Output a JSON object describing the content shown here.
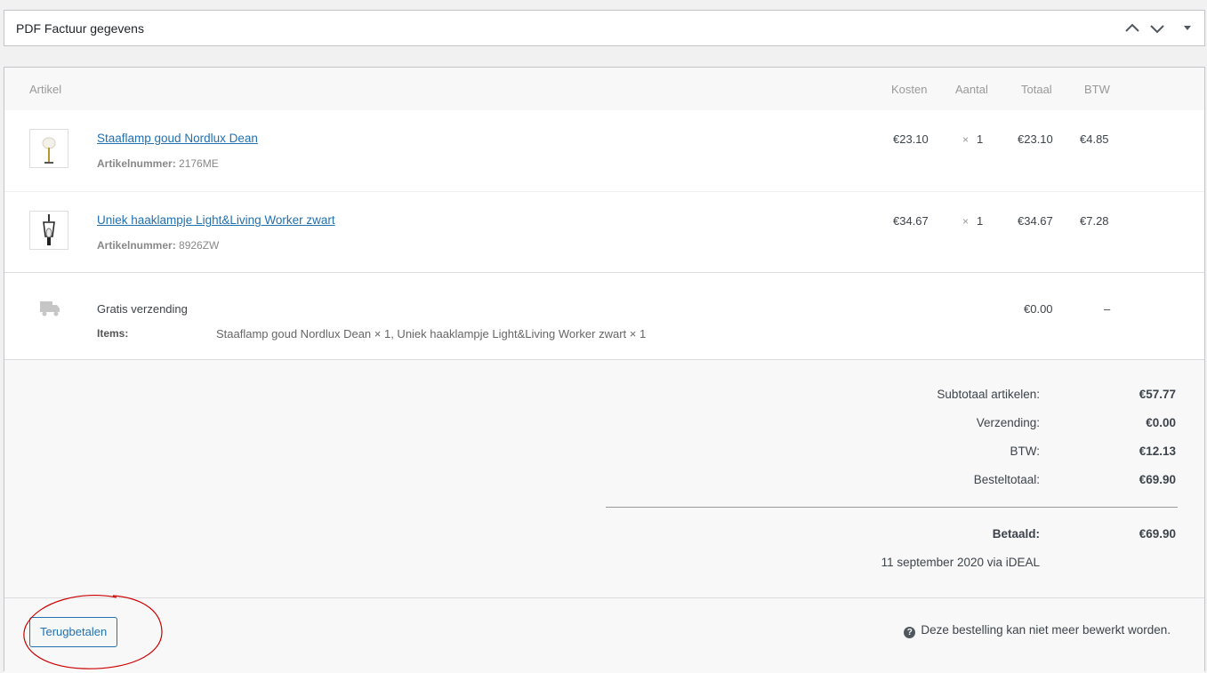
{
  "postbox": {
    "title": "PDF Factuur gegevens"
  },
  "table": {
    "headers": {
      "item": "Artikel",
      "cost": "Kosten",
      "qty": "Aantal",
      "total": "Totaal",
      "tax": "BTW"
    },
    "items": [
      {
        "name": "Staaflamp goud Nordlux Dean",
        "sku_label": "Artikelnummer:",
        "sku": "2176ME",
        "cost": "€23.10",
        "qty_prefix": "×",
        "qty": "1",
        "total": "€23.10",
        "tax": "€4.85"
      },
      {
        "name": "Uniek haaklampje Light&Living Worker zwart",
        "sku_label": "Artikelnummer:",
        "sku": "8926ZW",
        "cost": "€34.67",
        "qty_prefix": "×",
        "qty": "1",
        "total": "€34.67",
        "tax": "€7.28"
      }
    ],
    "shipping": {
      "method": "Gratis verzending",
      "items_label": "Items:",
      "items": "Staaflamp goud Nordlux Dean × 1, Uniek haaklampje Light&Living Worker zwart × 1",
      "total": "€0.00",
      "tax": "–"
    }
  },
  "totals": {
    "subtotal_label": "Subtotaal artikelen:",
    "subtotal": "€57.77",
    "shipping_label": "Verzending:",
    "shipping": "€0.00",
    "tax_label": "BTW:",
    "tax": "€12.13",
    "order_total_label": "Besteltotaal:",
    "order_total": "€69.90",
    "paid_label": "Betaald:",
    "paid": "€69.90",
    "paid_note": "11 september 2020 via iDEAL"
  },
  "actions": {
    "refund_label": "Terugbetalen",
    "notice": "Deze bestelling kan niet meer bewerkt worden."
  },
  "colors": {
    "link": "#2271b1",
    "annotation": "#cc0000"
  }
}
